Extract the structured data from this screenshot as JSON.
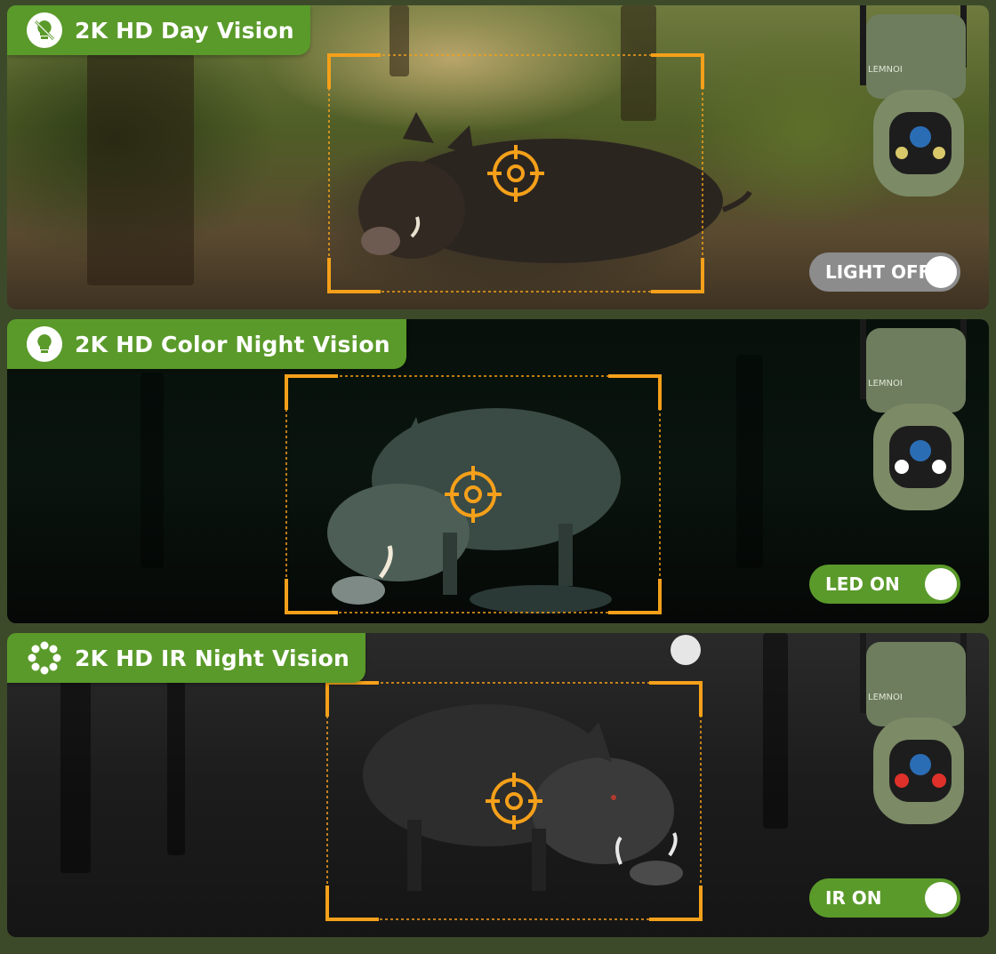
{
  "panels": [
    {
      "title": "2K HD Day Vision",
      "icon": "light-off-icon",
      "toggle_label": "LIGHT OFF",
      "toggle_state": "off"
    },
    {
      "title": "2K HD Color Night Vision",
      "icon": "bulb-icon",
      "toggle_label": "LED ON",
      "toggle_state": "on"
    },
    {
      "title": "2K HD IR Night Vision",
      "icon": "ir-dots-icon",
      "toggle_label": "IR ON",
      "toggle_state": "on"
    }
  ],
  "brand": "LEMNOI",
  "colors": {
    "tab_green": "#5a9a2a",
    "reticle_orange": "#f5a01a",
    "toggle_off": "#8c8c8c"
  }
}
